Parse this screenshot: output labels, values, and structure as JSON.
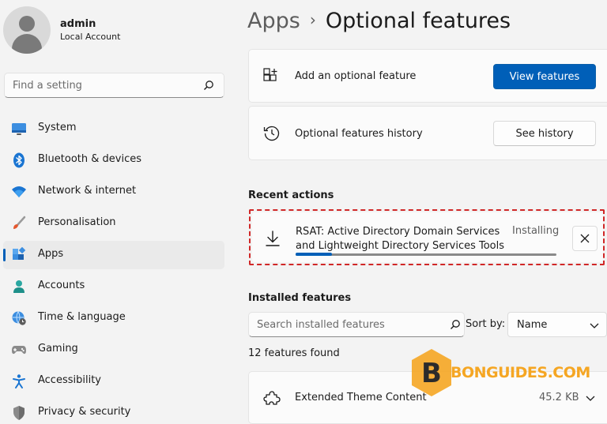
{
  "profile": {
    "name": "admin",
    "account_type": "Local Account"
  },
  "search": {
    "placeholder": "Find a setting"
  },
  "sidebar": {
    "items": [
      {
        "label": "System",
        "icon": "monitor-icon",
        "selected": false
      },
      {
        "label": "Bluetooth & devices",
        "icon": "bluetooth-icon",
        "selected": false
      },
      {
        "label": "Network & internet",
        "icon": "wifi-icon",
        "selected": false
      },
      {
        "label": "Personalisation",
        "icon": "brush-icon",
        "selected": false
      },
      {
        "label": "Apps",
        "icon": "apps-icon",
        "selected": true
      },
      {
        "label": "Accounts",
        "icon": "person-icon",
        "selected": false
      },
      {
        "label": "Time & language",
        "icon": "globe-clock-icon",
        "selected": false
      },
      {
        "label": "Gaming",
        "icon": "gamepad-icon",
        "selected": false
      },
      {
        "label": "Accessibility",
        "icon": "accessibility-icon",
        "selected": false
      },
      {
        "label": "Privacy & security",
        "icon": "shield-icon",
        "selected": false
      }
    ]
  },
  "breadcrumb": {
    "parent": "Apps",
    "separator": "›",
    "current": "Optional features"
  },
  "add_feature": {
    "label": "Add an optional feature",
    "button": "View features",
    "icon": "add-grid-icon"
  },
  "history": {
    "label": "Optional features history",
    "button": "See history",
    "icon": "history-icon"
  },
  "recent": {
    "section_title": "Recent actions",
    "item": {
      "title": "RSAT: Active Directory Domain Services and Lightweight Directory Services Tools",
      "status": "Installing",
      "progress": 0.14,
      "icon": "download-icon"
    }
  },
  "installed": {
    "section_title": "Installed features",
    "search_placeholder": "Search installed features",
    "sort_label": "Sort by:",
    "sort_value": "Name",
    "count_text": "12 features found",
    "features": [
      {
        "name": "Extended Theme Content",
        "size": "45.2 KB",
        "icon": "puzzle-icon"
      }
    ]
  },
  "watermark": {
    "text": "BONGUIDES.COM",
    "letter": "B"
  },
  "colors": {
    "accent": "#005fb8",
    "highlight_border": "#d02828",
    "watermark": "#f5a623"
  }
}
